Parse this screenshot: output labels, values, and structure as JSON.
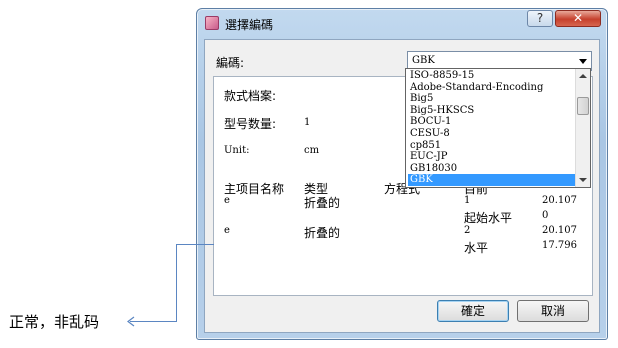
{
  "window": {
    "title": "選擇編碼",
    "help_label": "?",
    "close_label": "✕",
    "app_icon": "app-icon"
  },
  "encoding": {
    "label": "編碼:",
    "selected": "GBK"
  },
  "dropdown": {
    "options": [
      "ISO-8859-15",
      "Adobe-Standard-Encoding",
      "Big5",
      "Big5-HKSCS",
      "BOCU-1",
      "CESU-8",
      "cp851",
      "EUC-JP",
      "GB18030",
      "GBK"
    ],
    "selected_index": 9
  },
  "preview": {
    "style_label": "款式档案:",
    "model_qty_label": "型号数量:",
    "model_qty_value": "1",
    "unit_label": "Unit:",
    "unit_value": "cm",
    "col_name": "主项目名称",
    "col_type": "类型",
    "col_eq": "方程式",
    "col_cut": "目前",
    "rows": [
      {
        "name": "e",
        "type": "折叠的",
        "c1": "1",
        "c2": "20.107"
      },
      {
        "c1": "起始水平",
        "c2": "0"
      },
      {
        "name": "e",
        "type": "折叠的",
        "c1": "2",
        "c2": "20.107"
      },
      {
        "c1": "水平",
        "c2": "17.796"
      }
    ]
  },
  "buttons": {
    "ok": "確定",
    "cancel": "取消"
  },
  "annotation": {
    "text": "正常，非乱码",
    "arrow_color": "#5b86c2"
  }
}
